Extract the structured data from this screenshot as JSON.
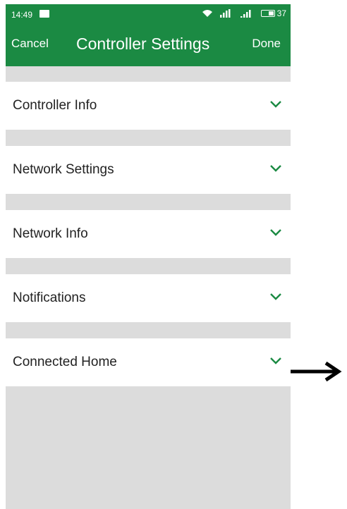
{
  "status_bar": {
    "time": "14:49",
    "battery_level": "37"
  },
  "header": {
    "cancel_label": "Cancel",
    "title": "Controller Settings",
    "done_label": "Done",
    "background_color": "#1b8a43"
  },
  "settings": {
    "items": [
      {
        "label": "Controller Info"
      },
      {
        "label": "Network Settings"
      },
      {
        "label": "Network Info"
      },
      {
        "label": "Notifications"
      },
      {
        "label": "Connected Home"
      }
    ],
    "chevron_icon": "chevron-down-icon",
    "chevron_color": "#1b8a43"
  },
  "annotation": {
    "icon": "arrow-right-icon",
    "color": "#000000"
  }
}
